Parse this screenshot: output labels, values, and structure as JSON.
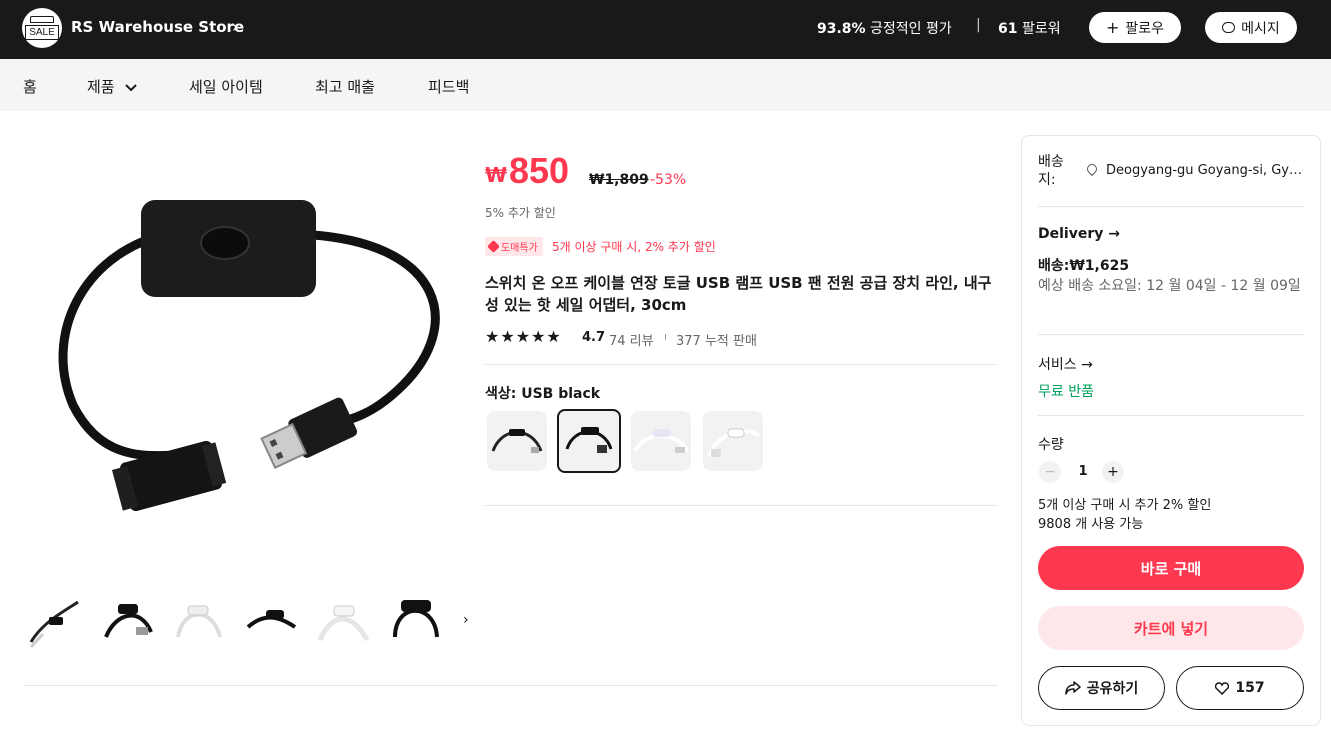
{
  "header": {
    "store_name": "RS Warehouse Store",
    "logo_text": "SALE",
    "positive_pct": "93.8%",
    "positive_label": "긍정적인 평가",
    "separator": "|",
    "followers_count": "61",
    "followers_label": "팔로워",
    "follow_button": "팔로우",
    "message_button": "메시지"
  },
  "nav": {
    "items": [
      "홈",
      "제품",
      "세일 아이템",
      "최고 매출",
      "피드백"
    ]
  },
  "product": {
    "currency": "₩",
    "price": "850",
    "original_price": "₩1,809",
    "discount": "-53%",
    "extra_discount": "5% 추가 할인",
    "promo_tag": "도매특가",
    "promo_text": "5개 이상 구매 시, 2% 추가 할인",
    "title": "스위치 온 오프 케이블 연장 토글 USB 램프 USB 팬 전원 공급 장치 라인, 내구성 있는 핫 세일 어댑터, 30cm",
    "stars": "★★★★★",
    "rating": "4.7",
    "reviews": "74 리뷰",
    "dot": "ı",
    "sold": "377 누적 판매",
    "color_label": "색상: USB black",
    "swatch_count": 4,
    "selected_swatch": 2
  },
  "sidebar": {
    "ship_to_label": "배송지:",
    "ship_to_location": "Deogyang-gu Goyang-si, Gyeonggi-do",
    "delivery_heading": "Delivery →",
    "delivery_fee": "배송:₩1,625",
    "delivery_eta": "예상 배송 소요일: 12 월 04일 - 12 월 09일",
    "service_heading": "서비스 →",
    "service_value": "무료 반품",
    "quantity_heading": "수량",
    "quantity_value": "1",
    "minus": "−",
    "plus": "+",
    "quantity_note": "5개 이상 구매 시 추가 2% 할인",
    "stock_note": "9808 개 사용 가능",
    "buy_now": "바로 구매",
    "add_to_cart": "카트에 넣기",
    "share": "공유하기",
    "wishlist_count": "157"
  },
  "colors": {
    "accent": "#fd384f",
    "accent_light": "#ffe7e9",
    "header_bg": "#191919",
    "service_green": "#00a05b"
  }
}
